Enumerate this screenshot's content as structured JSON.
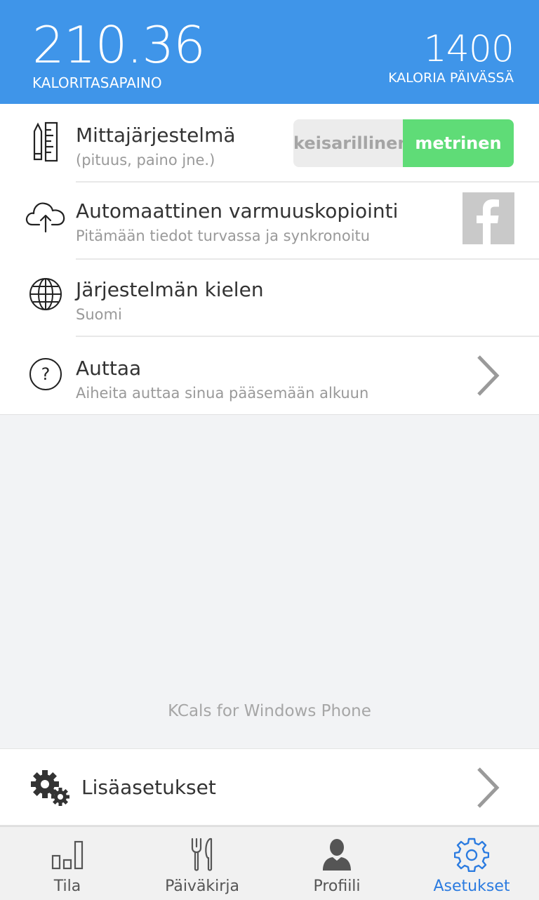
{
  "header": {
    "balance_value": "210.36",
    "balance_label": "KALORITASAPAINO",
    "daily_value": "1400",
    "daily_label": "KALORIA PÄIVÄSSÄ",
    "color": "#3f95e9"
  },
  "settings": {
    "units": {
      "title": "Mittajärjestelmä",
      "subtitle": "(pituus, paino jne.)",
      "icon": "ruler-pencil-icon",
      "options": [
        "keisarillinen",
        "metrinen"
      ],
      "selected": "metrinen"
    },
    "backup": {
      "title": "Automaattinen varmuuskopiointi",
      "subtitle": "Pitämään tiedot turvassa ja synkronoitu",
      "icon": "cloud-upload-icon",
      "action_icon": "facebook-icon"
    },
    "language": {
      "title": "Järjestelmän kielen",
      "subtitle": "Suomi",
      "icon": "globe-icon"
    },
    "help": {
      "title": "Auttaa",
      "subtitle": "Aiheita auttaa sinua pääsemään alkuun",
      "icon": "question-icon"
    }
  },
  "footer_text": "KCals for Windows Phone",
  "advanced": {
    "label": "Lisäasetukset",
    "icon": "gears-icon"
  },
  "nav": {
    "items": [
      {
        "label": "Tila",
        "icon": "bar-chart-icon"
      },
      {
        "label": "Päiväkirja",
        "icon": "fork-knife-icon"
      },
      {
        "label": "Profiili",
        "icon": "person-icon"
      },
      {
        "label": "Asetukset",
        "icon": "gear-icon"
      }
    ],
    "active": "Asetukset",
    "active_color": "#2b7be0"
  }
}
